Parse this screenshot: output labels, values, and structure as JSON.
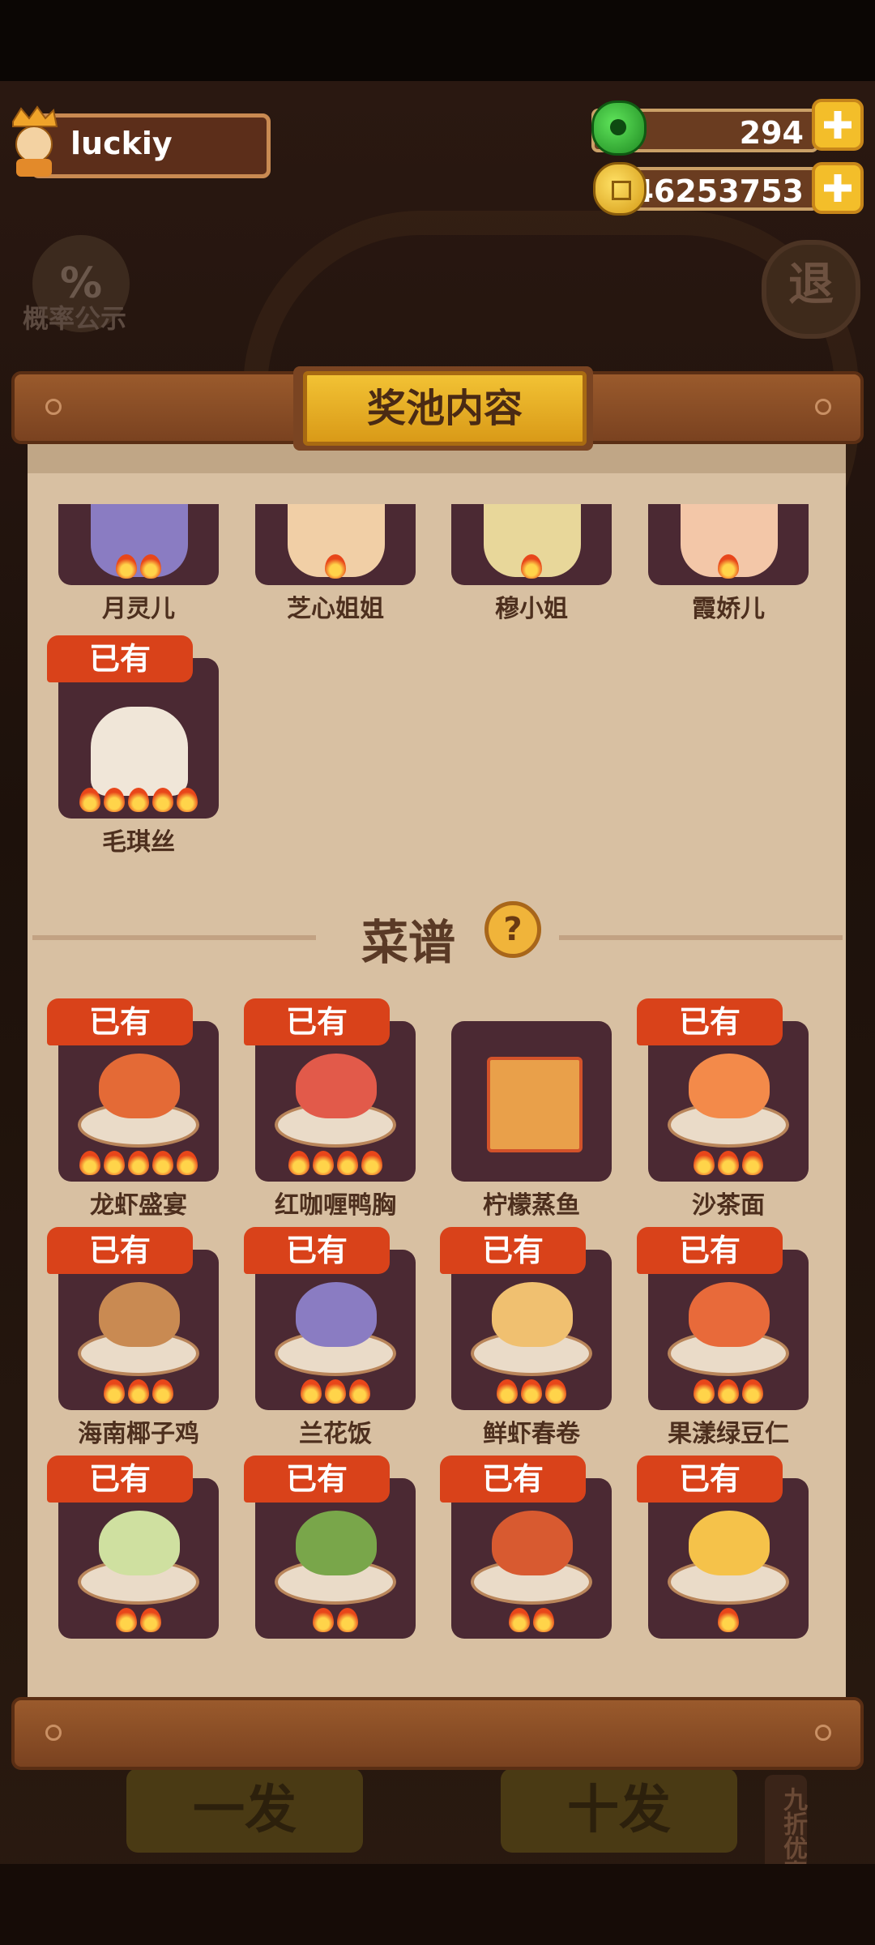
{
  "hud": {
    "username": "luckiy",
    "jade_count": "294",
    "coin_count": "46253753"
  },
  "background": {
    "probability_label": "概率公示",
    "probability_icon": "%",
    "exit_label": "退",
    "single_draw": "一发",
    "ten_draw": "十发",
    "discount_label": "九折优惠"
  },
  "modal": {
    "title": "奖池内容",
    "recipes_title": "菜谱",
    "help_icon": "?",
    "owned_label": "已有"
  },
  "characters": [
    {
      "name": "月灵儿",
      "flames": 2,
      "owned": false
    },
    {
      "name": "芝心姐姐",
      "flames": 1,
      "owned": false
    },
    {
      "name": "穆小姐",
      "flames": 1,
      "owned": false
    },
    {
      "name": "霞娇儿",
      "flames": 1,
      "owned": false
    },
    {
      "name": "毛琪丝",
      "flames": 5,
      "owned": true
    }
  ],
  "recipes": [
    {
      "name": "龙虾盛宴",
      "flames": 5,
      "owned": true
    },
    {
      "name": "红咖喱鸭胸",
      "flames": 4,
      "owned": true
    },
    {
      "name": "柠檬蒸鱼",
      "flames": 0,
      "owned": false
    },
    {
      "name": "沙茶面",
      "flames": 3,
      "owned": true
    },
    {
      "name": "海南椰子鸡",
      "flames": 3,
      "owned": true
    },
    {
      "name": "兰花饭",
      "flames": 3,
      "owned": true
    },
    {
      "name": "鲜虾春卷",
      "flames": 3,
      "owned": true
    },
    {
      "name": "果漾绿豆仁",
      "flames": 3,
      "owned": true
    },
    {
      "name": "",
      "flames": 2,
      "owned": true
    },
    {
      "name": "",
      "flames": 2,
      "owned": true
    },
    {
      "name": "",
      "flames": 2,
      "owned": true
    },
    {
      "name": "",
      "flames": 1,
      "owned": true
    }
  ],
  "colors": {
    "badge": "#d9421a",
    "tile": "#4b2933",
    "panel": "#d8c0a2",
    "gold": "#f3be2a"
  }
}
